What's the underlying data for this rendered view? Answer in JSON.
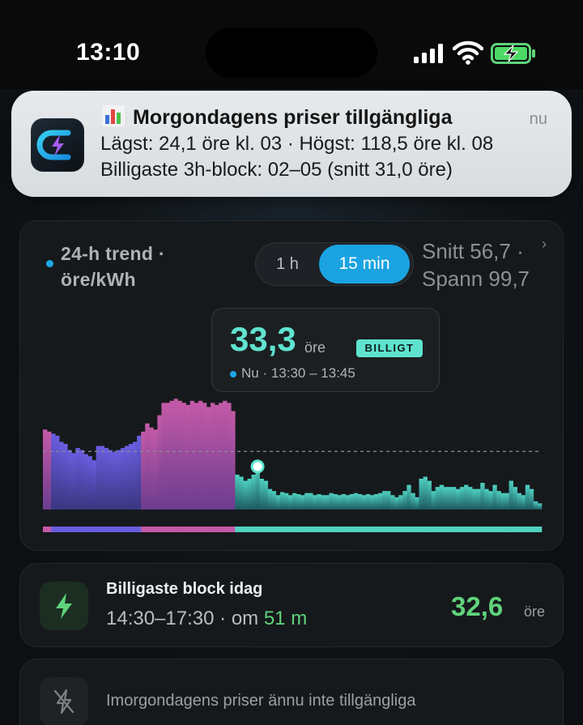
{
  "status_bar": {
    "time": "13:10"
  },
  "notification": {
    "title": "Morgondagens priser tillgängliga",
    "line1": "Lägst: 24,1 öre kl. 03 · Högst: 118,5 öre kl. 08",
    "line2": "Billigaste 3h-block: 02–05 (snitt 31,0 öre)",
    "time": "nu",
    "icon": "app-bolt-icon"
  },
  "trend": {
    "title": "24-h trend · öre/kWh",
    "segments": [
      "1 h",
      "15 min"
    ],
    "selected_segment": "15 min",
    "stat_avg": "Snitt 56,7 ·",
    "stat_span": "Spann 99,7",
    "accent": "#1aa3e0",
    "tooltip": {
      "price": "33,3",
      "unit": "öre",
      "badge": "BILLIGT",
      "time": "Nu · 13:30 – 13:45"
    }
  },
  "chart_data": {
    "type": "bar",
    "unit": "öre/kWh",
    "interval": "15 min",
    "average": 56.7,
    "current_index": 52,
    "ylim": [
      0,
      118.5
    ],
    "values": [
      78,
      76,
      74,
      72,
      66,
      64,
      58,
      55,
      60,
      58,
      54,
      52,
      48,
      62,
      62,
      60,
      58,
      56,
      58,
      60,
      62,
      64,
      66,
      72,
      76,
      84,
      80,
      78,
      92,
      104,
      104,
      106,
      108,
      106,
      104,
      102,
      106,
      104,
      106,
      104,
      100,
      104,
      102,
      104,
      106,
      104,
      96,
      34,
      32,
      28,
      30,
      34,
      42,
      30,
      28,
      20,
      18,
      14,
      17,
      16,
      14,
      16,
      15,
      14,
      16,
      16,
      14,
      15,
      14,
      14,
      16,
      15,
      14,
      15,
      14,
      15,
      16,
      15,
      14,
      15,
      14,
      15,
      16,
      18,
      18,
      14,
      12,
      14,
      18,
      24,
      16,
      12,
      30,
      32,
      28,
      18,
      22,
      24,
      22,
      22,
      22,
      20,
      22,
      24,
      22,
      20,
      20,
      26,
      20,
      18,
      24,
      18,
      16,
      16,
      28,
      22,
      16,
      14,
      24,
      20,
      8,
      6
    ]
  },
  "cheapest_block": {
    "title": "Billigaste block idag",
    "time": "14:30–17:30",
    "sep": "·",
    "in_label": "om",
    "in_value": "51 m",
    "price": "32,6",
    "unit": "öre",
    "color": "#5fd37b"
  },
  "tomorrow": {
    "text": "Imorgondagens priser ännu inte tillgängliga"
  }
}
